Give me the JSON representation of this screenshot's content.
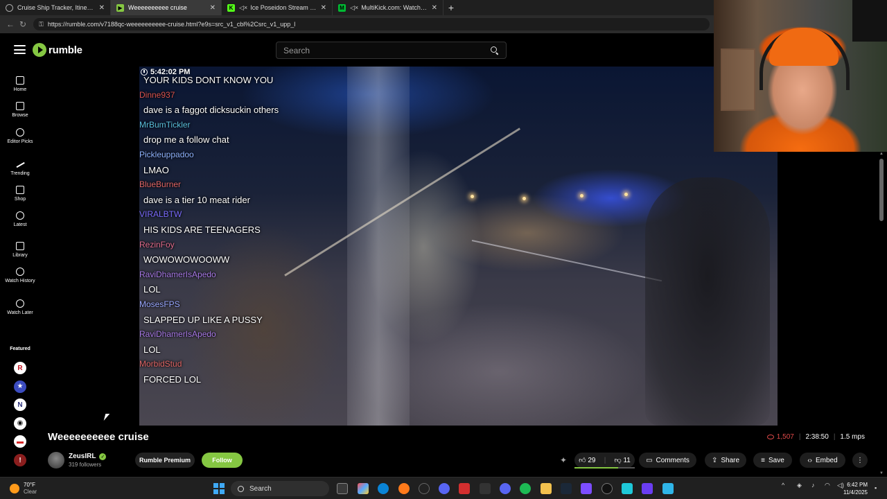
{
  "browser": {
    "tabs": [
      {
        "label": "Cruise Ship Tracker, Itineraries, Sc",
        "favicon": "globe-icon",
        "active": false,
        "muted": false
      },
      {
        "label": "Weeeeeeeeee cruise",
        "favicon": "rumble-icon",
        "active": true,
        "muted": false
      },
      {
        "label": "Ice Poseidon Stream - Watch",
        "favicon": "kick-icon",
        "active": false,
        "muted": true
      },
      {
        "label": "MultiKick.com: Watch Multip",
        "favicon": "multikick-icon",
        "active": false,
        "muted": true
      }
    ],
    "new_tab": "+",
    "url": "https://rumble.com/v7188qc-weeeeeeeeee-cruise.html?e9s=src_v1_cbl%2Csrc_v1_upp_l"
  },
  "header": {
    "logo_text": "rumble",
    "search_placeholder": "Search",
    "brand_color": "#85c742"
  },
  "sidebar": {
    "items": [
      {
        "label": "Home",
        "icon": "home-icon"
      },
      {
        "label": "Browse",
        "icon": "browse-icon"
      },
      {
        "label": "Editor Picks",
        "icon": "editor-picks-icon"
      },
      {
        "label": "Trending",
        "icon": "trending-icon"
      },
      {
        "label": "Shop",
        "icon": "shop-icon"
      },
      {
        "label": "Latest",
        "icon": "clock-icon"
      },
      {
        "label": "Library",
        "icon": "library-icon"
      },
      {
        "label": "Watch History",
        "icon": "history-icon"
      },
      {
        "label": "Watch Later",
        "icon": "watch-later-icon"
      }
    ],
    "featured_label": "Featured",
    "featured_channels": [
      {
        "glyph": "R",
        "bg": "#ffffff",
        "fg": "#c1121f"
      },
      {
        "glyph": "★",
        "bg": "#3b4cc0",
        "fg": "#ffffff"
      },
      {
        "glyph": "N",
        "bg": "#ffffff",
        "fg": "#2a2f7a"
      },
      {
        "glyph": "◉",
        "bg": "#ffffff",
        "fg": "#111111"
      },
      {
        "glyph": "▬",
        "bg": "#ffffff",
        "fg": "#d62828"
      },
      {
        "glyph": "!",
        "bg": "#8b1e1e",
        "fg": "#ffffff"
      }
    ]
  },
  "video": {
    "timestamp": "5:42:02 PM",
    "chat": [
      {
        "kind": "msg",
        "text": "YOUR KIDS DONT KNOW YOU"
      },
      {
        "kind": "user",
        "text": "Dinne937",
        "color": "#d9534f"
      },
      {
        "kind": "msg",
        "text": "dave is a faggot dicksuckin others"
      },
      {
        "kind": "user",
        "text": "MrBumTickler",
        "color": "#5bc0de"
      },
      {
        "kind": "msg",
        "text": "drop me a follow chat"
      },
      {
        "kind": "user",
        "text": "Pickleuppadoo",
        "color": "#8fb3ff"
      },
      {
        "kind": "msg",
        "text": "LMAO"
      },
      {
        "kind": "user",
        "text": "BlueBurner",
        "color": "#e06666"
      },
      {
        "kind": "msg",
        "text": "dave is a tier 10 meat rider"
      },
      {
        "kind": "user",
        "text": "VIRALBTW",
        "color": "#7b6cff"
      },
      {
        "kind": "msg",
        "text": "HIS KIDS ARE TEENAGERS"
      },
      {
        "kind": "user",
        "text": "RezinFoy",
        "color": "#e06c8c"
      },
      {
        "kind": "msg",
        "text": "WOWOWOWOOWW"
      },
      {
        "kind": "user",
        "text": "RaviDhamerIsApedo",
        "color": "#a879e6"
      },
      {
        "kind": "msg",
        "text": "LOL"
      },
      {
        "kind": "user",
        "text": "MosesFPS",
        "color": "#9aa8ff"
      },
      {
        "kind": "msg",
        "text": "SLAPPED UP LIKE A PUSSY"
      },
      {
        "kind": "user",
        "text": "RaviDhamerIsApedo",
        "color": "#a879e6"
      },
      {
        "kind": "msg",
        "text": "LOL"
      },
      {
        "kind": "user",
        "text": "MorbidStud",
        "color": "#e06666"
      },
      {
        "kind": "msg",
        "text": "FORCED LOL"
      }
    ]
  },
  "details": {
    "title": "Weeeeeeeeee cruise",
    "views": "1,507",
    "duration": "2:38:50",
    "bitrate": "1.5 mps",
    "channel_name": "ZeusIRL",
    "followers": "319 followers",
    "premium_label": "Rumble Premium",
    "follow_label": "Follow",
    "likes": "29",
    "dislikes": "11",
    "like_fraction": 0.725,
    "comments_label": "Comments",
    "share_label": "Share",
    "save_label": "Save",
    "embed_label": "Embed"
  },
  "taskbar": {
    "temp": "70°F",
    "condition": "Clear",
    "search_label": "Search",
    "time": "6:42 PM",
    "date": "11/4/2025"
  }
}
